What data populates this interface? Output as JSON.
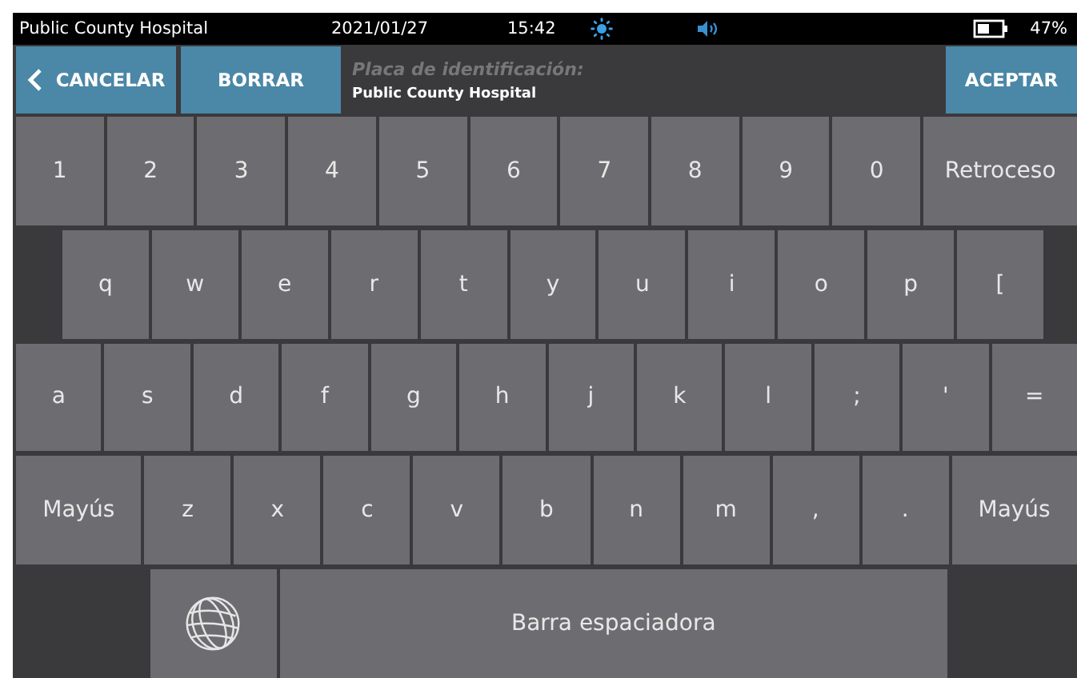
{
  "status_bar": {
    "name": "Public County Hospital",
    "date": "2021/01/27",
    "time": "15:42",
    "battery": "47%"
  },
  "header": {
    "buttons": [
      {
        "label": "CANCELAR",
        "kind": "back"
      },
      {
        "label": "BORRAR",
        "kind": "plain"
      }
    ],
    "field": {
      "placeholder": "Placa de identificación:",
      "value": "Public County Hospital"
    },
    "accept": "ACEPTAR"
  },
  "keyboard": {
    "rows": [
      {
        "keys": [
          {
            "label": "1",
            "kind": "char"
          },
          {
            "label": "2",
            "kind": "char"
          },
          {
            "label": "3",
            "kind": "char"
          },
          {
            "label": "4",
            "kind": "char"
          },
          {
            "label": "5",
            "kind": "char"
          },
          {
            "label": "6",
            "kind": "char"
          },
          {
            "label": "7",
            "kind": "char"
          },
          {
            "label": "8",
            "kind": "char"
          },
          {
            "label": "9",
            "kind": "char"
          },
          {
            "label": "0",
            "kind": "char"
          },
          {
            "label": "Retroceso",
            "kind": "wide"
          }
        ]
      },
      {
        "keys": [
          {
            "label": "q",
            "kind": "char"
          },
          {
            "label": "w",
            "kind": "char"
          },
          {
            "label": "e",
            "kind": "char"
          },
          {
            "label": "r",
            "kind": "char"
          },
          {
            "label": "t",
            "kind": "char"
          },
          {
            "label": "y",
            "kind": "char"
          },
          {
            "label": "u",
            "kind": "char"
          },
          {
            "label": "i",
            "kind": "char"
          },
          {
            "label": "o",
            "kind": "char"
          },
          {
            "label": "p",
            "kind": "char"
          },
          {
            "label": "[",
            "kind": "char"
          }
        ]
      },
      {
        "keys": [
          {
            "label": "a",
            "kind": "char"
          },
          {
            "label": "s",
            "kind": "char"
          },
          {
            "label": "d",
            "kind": "char"
          },
          {
            "label": "f",
            "kind": "char"
          },
          {
            "label": "g",
            "kind": "char"
          },
          {
            "label": "h",
            "kind": "char"
          },
          {
            "label": "j",
            "kind": "char"
          },
          {
            "label": "k",
            "kind": "char"
          },
          {
            "label": "l",
            "kind": "char"
          },
          {
            "label": ";",
            "kind": "char"
          },
          {
            "label": "'",
            "kind": "char"
          },
          {
            "label": "=",
            "kind": "char"
          }
        ]
      },
      {
        "keys": [
          {
            "label": "Mayús",
            "kind": "shift"
          },
          {
            "label": "z",
            "kind": "char"
          },
          {
            "label": "x",
            "kind": "char"
          },
          {
            "label": "c",
            "kind": "char"
          },
          {
            "label": "v",
            "kind": "char"
          },
          {
            "label": "b",
            "kind": "char"
          },
          {
            "label": "n",
            "kind": "char"
          },
          {
            "label": "m",
            "kind": "char"
          },
          {
            "label": ",",
            "kind": "char"
          },
          {
            "label": ".",
            "kind": "char"
          },
          {
            "label": "Mayús",
            "kind": "shift"
          }
        ]
      },
      {
        "keys": [
          {
            "kind": "globe"
          },
          {
            "label": "Barra espaciadora",
            "kind": "space"
          }
        ]
      }
    ]
  }
}
